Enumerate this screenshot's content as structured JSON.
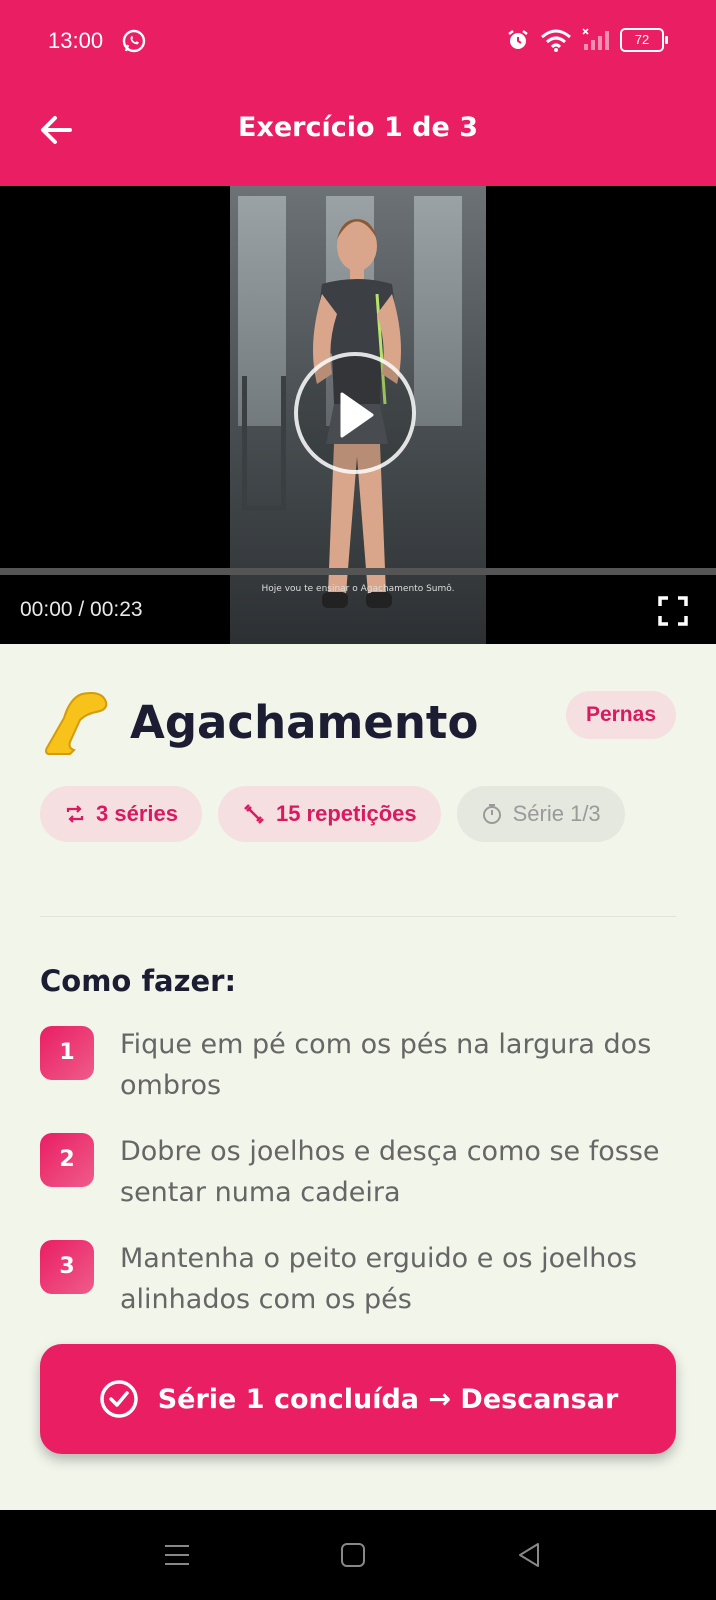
{
  "status_bar": {
    "time": "13:00",
    "battery": "72"
  },
  "header": {
    "title": "Exercício 1 de 3"
  },
  "video": {
    "caption": "Hoje vou te ensinar o Agachamento Sumô.",
    "time_label": "00:00 / 00:23",
    "progress": 0.0
  },
  "exercise": {
    "name": "Agachamento",
    "muscle_group": "Pernas",
    "chips": {
      "series": "3 séries",
      "reps": "15 repetições",
      "current": "Série 1/3"
    }
  },
  "instructions": {
    "title": "Como fazer:",
    "steps": [
      {
        "num": "1",
        "text": "Fique em pé com os pés na largura dos ombros"
      },
      {
        "num": "2",
        "text": "Dobre os joelhos e desça como se fosse sentar numa cadeira"
      },
      {
        "num": "3",
        "text": "Mantenha o peito erguido e os joelhos alinhados com os pés"
      }
    ]
  },
  "cta": {
    "label": "Série 1 concluída → Descansar"
  },
  "icons": {
    "back": "arrow-left-icon",
    "play": "play-icon",
    "fullscreen": "fullscreen-icon",
    "leg": "leg-emoji-icon",
    "repeat": "repeat-icon",
    "reps": "dumbbell-icon",
    "timer": "timer-icon",
    "check": "check-circle-icon"
  },
  "colors": {
    "brand": "#e91e63",
    "background": "#f1f5ea"
  }
}
